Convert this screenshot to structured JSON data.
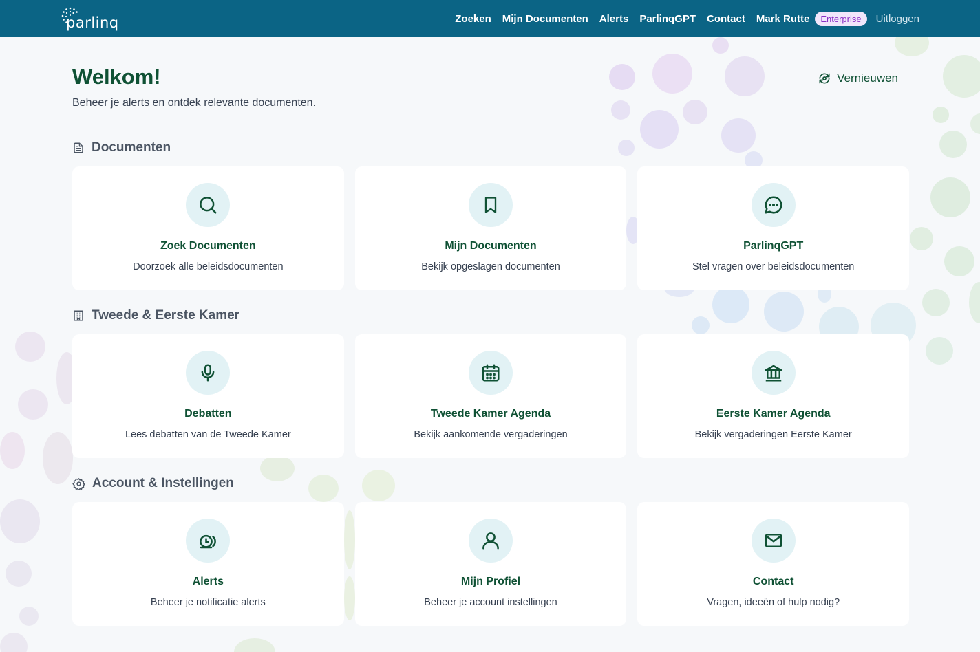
{
  "brand": {
    "name": "parlinq"
  },
  "nav": {
    "items": [
      "Zoeken",
      "Mijn Documenten",
      "Alerts",
      "ParlinqGPT",
      "Contact"
    ],
    "user": "Mark Rutte",
    "badge": "Enterprise",
    "logout": "Uitloggen"
  },
  "page": {
    "title": "Welkom!",
    "subtitle": "Beheer je alerts en ontdek relevante documenten.",
    "refresh": "Vernieuwen"
  },
  "sections": [
    {
      "title": "Documenten",
      "icon": "document-icon",
      "cards": [
        {
          "title": "Zoek Documenten",
          "desc": "Doorzoek alle beleidsdocumenten",
          "icon": "search-icon"
        },
        {
          "title": "Mijn Documenten",
          "desc": "Bekijk opgeslagen documenten",
          "icon": "bookmark-icon"
        },
        {
          "title": "ParlinqGPT",
          "desc": "Stel vragen over beleidsdocumenten",
          "icon": "chat-icon"
        }
      ]
    },
    {
      "title": "Tweede & Eerste Kamer",
      "icon": "building-icon",
      "cards": [
        {
          "title": "Debatten",
          "desc": "Lees debatten van de Tweede Kamer",
          "icon": "microphone-icon"
        },
        {
          "title": "Tweede Kamer Agenda",
          "desc": "Bekijk aankomende vergaderingen",
          "icon": "calendar-icon"
        },
        {
          "title": "Eerste Kamer Agenda",
          "desc": "Bekijk vergaderingen Eerste Kamer",
          "icon": "landmark-icon"
        }
      ]
    },
    {
      "title": "Account & Instellingen",
      "icon": "gear-icon",
      "cards": [
        {
          "title": "Alerts",
          "desc": "Beheer je notificatie alerts",
          "icon": "alarm-icon"
        },
        {
          "title": "Mijn Profiel",
          "desc": "Beheer je account instellingen",
          "icon": "user-icon"
        },
        {
          "title": "Contact",
          "desc": "Vragen, ideeën of hulp nodig?",
          "icon": "mail-icon"
        }
      ]
    }
  ],
  "colors": {
    "header": "#0b6485",
    "accent": "#0f5134",
    "icon_bg": "#e2f2f5",
    "badge_bg": "#f1e6fb",
    "badge_text": "#8a2fc4"
  }
}
